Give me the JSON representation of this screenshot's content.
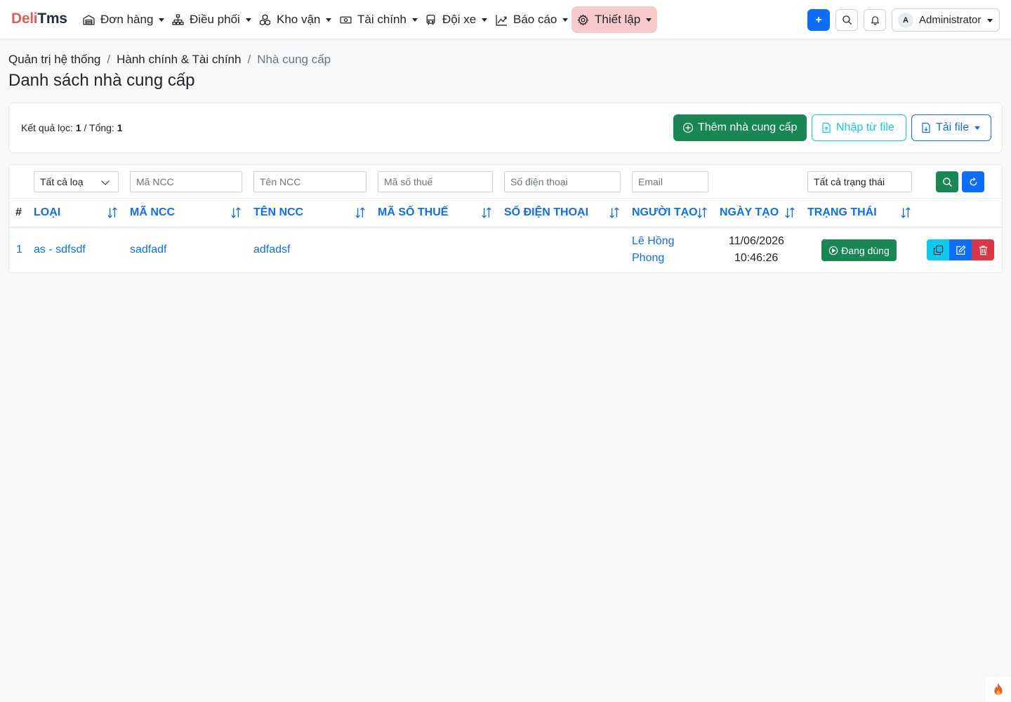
{
  "brand": {
    "part1": "Deli",
    "part2": "Tms"
  },
  "nav": {
    "items": [
      {
        "label": "Đơn hàng",
        "icon": "warehouse-icon"
      },
      {
        "label": "Điều phối",
        "icon": "diagram-icon"
      },
      {
        "label": "Kho vận",
        "icon": "boxes-icon"
      },
      {
        "label": "Tài chính",
        "icon": "cash-icon"
      },
      {
        "label": "Đội xe",
        "icon": "bus-icon"
      },
      {
        "label": "Báo cáo",
        "icon": "graph-icon"
      },
      {
        "label": "Thiết lập",
        "icon": "gear-icon"
      }
    ],
    "plus_label": "+",
    "user": {
      "initial": "A",
      "name": "Administrator"
    }
  },
  "breadcrumb": [
    "Quản trị hệ thống",
    "Hành chính & Tài chính",
    "Nhà cung cấp"
  ],
  "breadcrumb_sep": "/",
  "page_title": "Danh sách nhà cung cấp",
  "summary": {
    "result_label": "Kết quả lọc:",
    "result_count": "1",
    "total_label": "/ Tổng:",
    "total_count": "1"
  },
  "actions": {
    "add": "Thêm nhà cung cấp",
    "import": "Nhập từ file",
    "download": "Tải file"
  },
  "filters": {
    "type_select": "Tất cả loạ",
    "code_placeholder": "Mã NCC",
    "name_placeholder": "Tên NCC",
    "tax_placeholder": "Mã số thuế",
    "phone_placeholder": "Số điện thoại",
    "email_placeholder": "Email",
    "status_select": "Tất cả trạng thái"
  },
  "columns": {
    "hash": "#",
    "type": "Loại",
    "code": "Mã NCC",
    "name": "Tên NCC",
    "tax": "Mã số thuế",
    "phone": "Số điện thoại",
    "creator": "Người tạo",
    "created_at": "Ngày tạo",
    "status": "Trạng thái"
  },
  "rows": [
    {
      "index": "1",
      "type": "as - sdfsdf",
      "code": "sadfadf",
      "name": "adfadsf",
      "tax": "",
      "phone": "",
      "creator_line1": "Lê Hồng",
      "creator_line2": "Phong",
      "date": "11/06/2026",
      "time": "10:46:26",
      "status": "Đang dùng"
    }
  ],
  "colors": {
    "primary": "#0d6efd",
    "success": "#198754",
    "info": "#0dcaf0",
    "danger": "#dc3545",
    "brand_red": "#e35d5b",
    "active_nav_bg": "#f9caca"
  }
}
